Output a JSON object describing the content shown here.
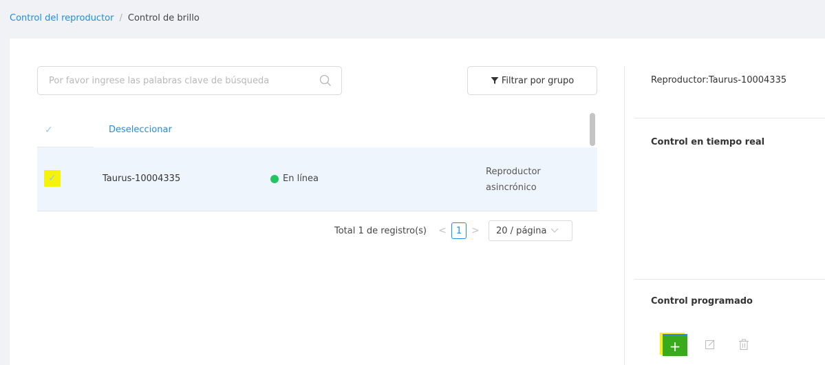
{
  "breadcrumb": {
    "parent": "Control del reproductor",
    "separator": "/",
    "current": "Control de brillo"
  },
  "search": {
    "placeholder": "Por favor ingrese las palabras clave de búsqueda",
    "value": ""
  },
  "filter": {
    "label": "Filtrar por grupo"
  },
  "table": {
    "deselect_label": "Deseleccionar",
    "rows": [
      {
        "name": "Taurus-10004335",
        "status": "En línea",
        "status_color": "#22c55e",
        "type_line1": "Reproductor",
        "type_line2": "asincrónico",
        "selected": true
      }
    ]
  },
  "pagination": {
    "total": "Total 1 de registro(s)",
    "prev": "<",
    "current_page": "1",
    "next": ">",
    "page_size": "20 / página"
  },
  "panel": {
    "player": "Reproductor:Taurus-10004335",
    "realtime_title": "Control en tiempo real",
    "scheduled_title": "Control programado",
    "add_label": "+"
  },
  "colors": {
    "accent": "#1d8ee6",
    "online": "#22c55e",
    "add_button": "#3aaa1d",
    "highlight": "#f5f20b"
  }
}
